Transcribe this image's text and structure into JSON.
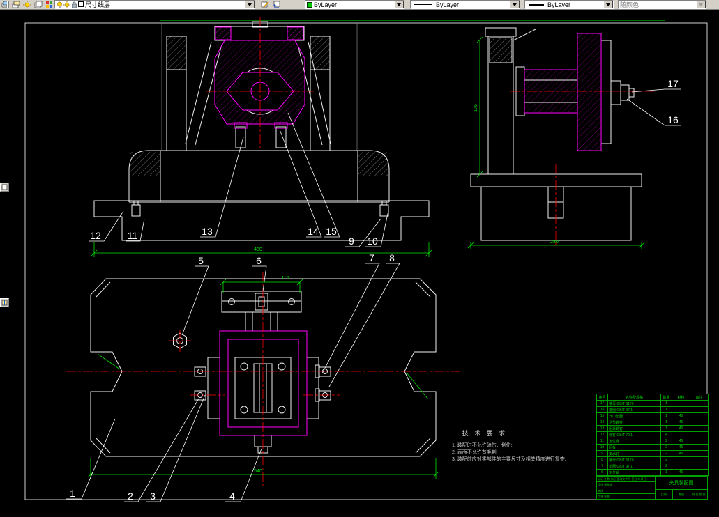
{
  "toolbar": {
    "layer_combo": {
      "value": "尺寸线层"
    },
    "color_combo": {
      "value": "ByLayer"
    },
    "linetype_combo": {
      "value": "ByLayer"
    },
    "lineweight_combo": {
      "value": "ByLayer"
    },
    "plotstyle_combo": {
      "value": "随颜色"
    }
  },
  "colors": {
    "outline_white": "#f0f0f0",
    "part_magenta": "#ff00ff",
    "dimension_green": "#00e500",
    "centerline_red": "#ff0000",
    "table_green": "#00a000"
  },
  "drawing": {
    "callouts": [
      "1",
      "2",
      "3",
      "4",
      "5",
      "6",
      "7",
      "8",
      "9",
      "10",
      "11",
      "12",
      "13",
      "14",
      "15",
      "16",
      "17"
    ],
    "dimensions": {
      "plan_slide_width": "110",
      "plan_total_width": "540",
      "front_total_width": "480",
      "side_height": "175",
      "side_base_width": "280"
    },
    "tech": {
      "title": "技 术 要 求",
      "items": [
        "1. 装配时不允许磕伤、划伤;",
        "2. 表面不允许有毛刺;",
        "3. 装配前应对零部件的主要尺寸及相关精度进行复查;"
      ]
    },
    "bom": {
      "headers": [
        "序号",
        "名称及规格",
        "数量",
        "材料",
        "备注"
      ],
      "rows": [
        {
          "no": "17",
          "name": "螺母 GB/T 6170",
          "qty": "1",
          "mat": "",
          "rem": ""
        },
        {
          "no": "16",
          "name": "垫圈 GB/T 97.1",
          "qty": "1",
          "mat": "",
          "rem": ""
        },
        {
          "no": "15",
          "name": "开口垫圈",
          "qty": "1",
          "mat": "45",
          "rem": ""
        },
        {
          "no": "14",
          "name": "活节螺栓",
          "qty": "1",
          "mat": "45",
          "rem": ""
        },
        {
          "no": "13",
          "name": "压紧螺钉",
          "qty": "1",
          "mat": "45",
          "rem": ""
        },
        {
          "no": "12",
          "name": "螺钉 GB/T 70.1",
          "qty": "4",
          "mat": "",
          "rem": ""
        },
        {
          "no": "11",
          "name": "定位键",
          "qty": "2",
          "mat": "45",
          "rem": ""
        },
        {
          "no": "10",
          "name": "压板",
          "qty": "2",
          "mat": "45",
          "rem": ""
        },
        {
          "no": "9",
          "name": "支承钉",
          "qty": "2",
          "mat": "45",
          "rem": ""
        },
        {
          "no": "8",
          "name": "螺母 GB/T 6170",
          "qty": "2",
          "mat": "",
          "rem": ""
        },
        {
          "no": "7",
          "name": "垫圈 GB/T 97.1",
          "qty": "2",
          "mat": "",
          "rem": ""
        },
        {
          "no": "6",
          "name": "定位销",
          "qty": "1",
          "mat": "45",
          "rem": ""
        }
      ]
    },
    "title_block": {
      "title": "夹具装配图",
      "row1": "标记 处数 分区 更改文件号 签名 年月日",
      "row2": "设计  标准化",
      "row3": "审核",
      "row4": "工艺  批准",
      "scale_label": "比例",
      "qty_label": "数量",
      "sheet_label": "共 张 第 张"
    }
  }
}
